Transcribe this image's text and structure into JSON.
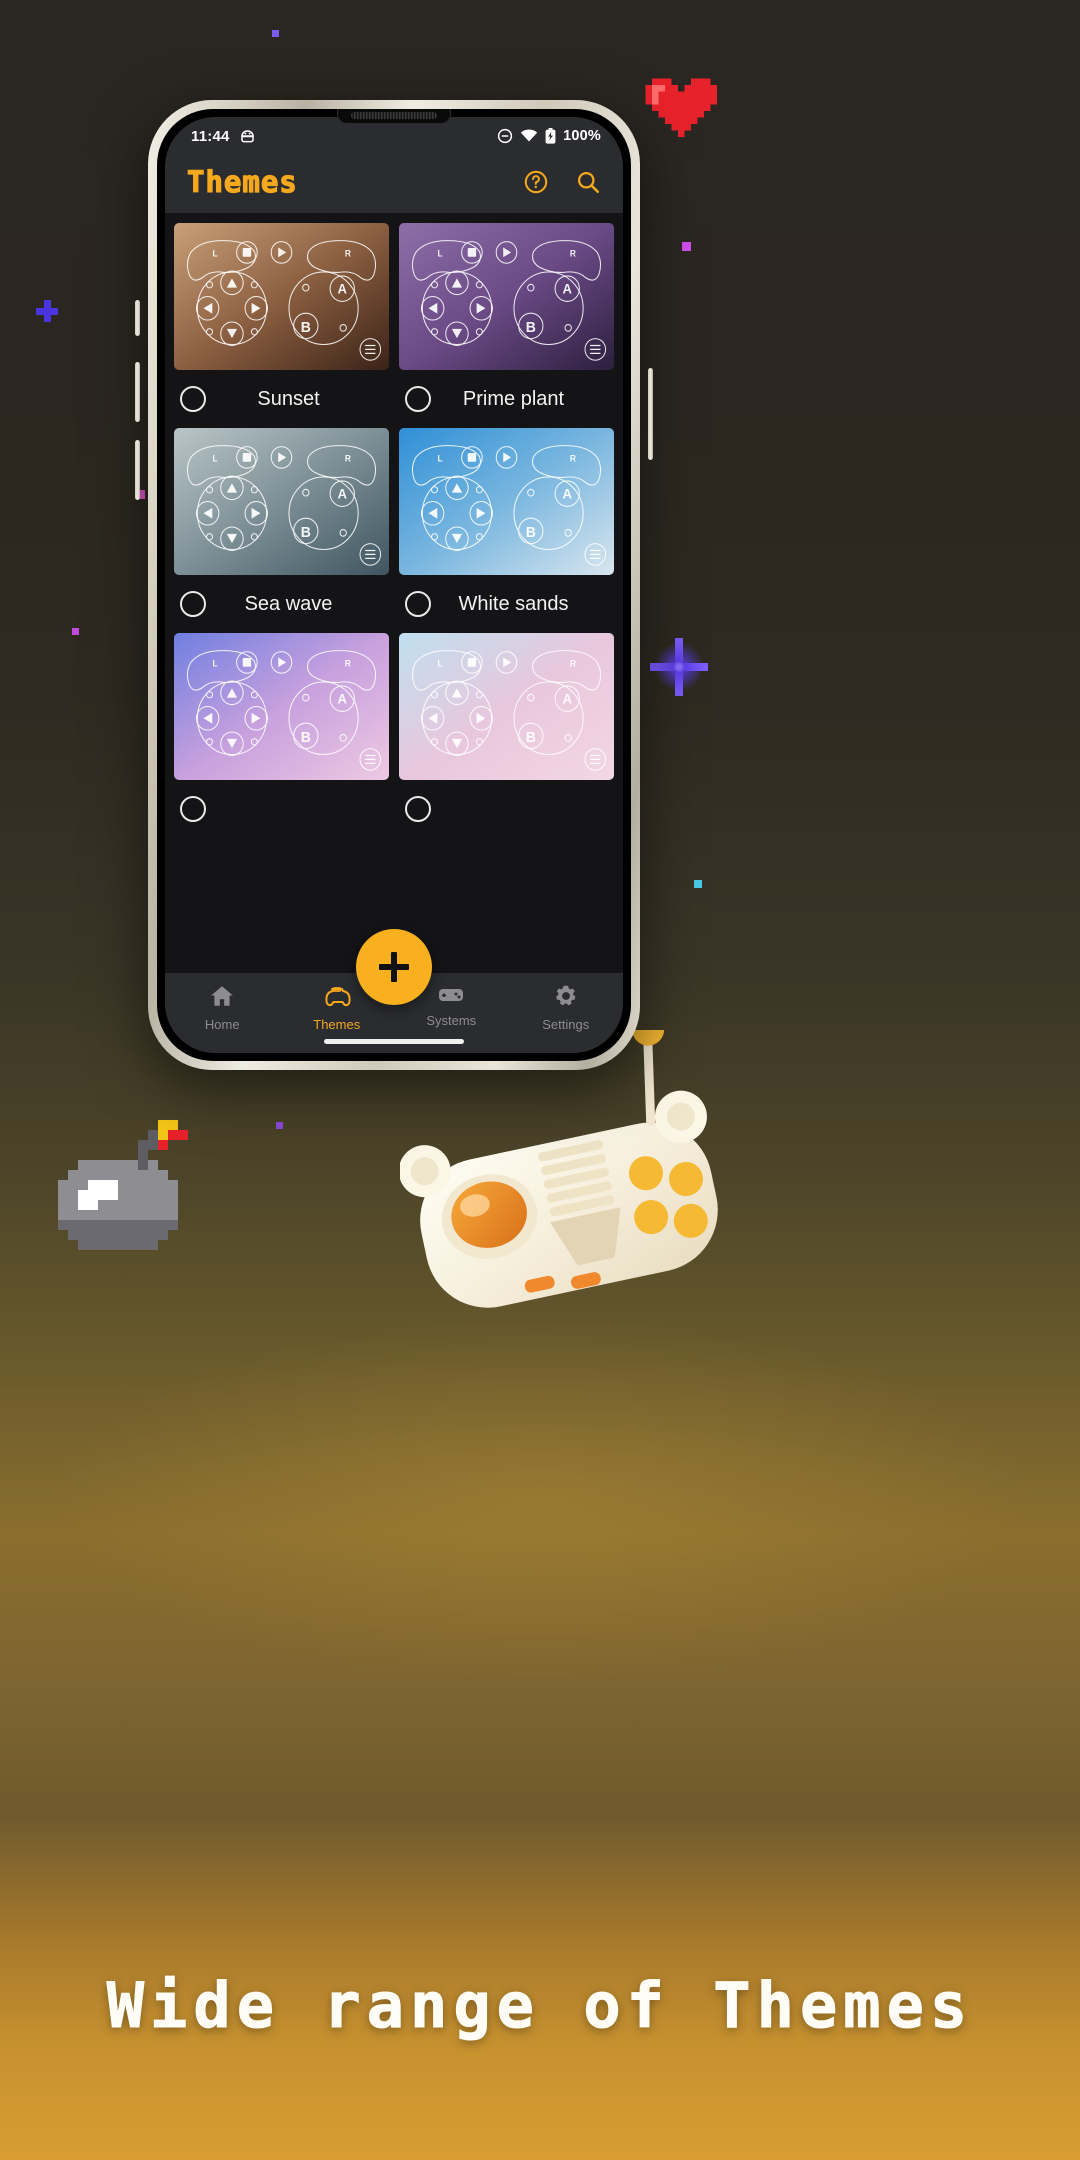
{
  "poster": {
    "caption": "Wide range of Themes",
    "bg_top": "#2a2621",
    "bg_bottom": "#d89c33"
  },
  "status_bar": {
    "time": "11:44",
    "left_icon": "android-icon",
    "dnd_icon": "do-not-disturb-icon",
    "wifi_icon": "wifi-icon",
    "battery_icon": "battery-charging-icon",
    "battery_text": "100%"
  },
  "app_bar": {
    "title": "Themes",
    "help_icon": "help-circle-icon",
    "search_icon": "search-icon",
    "accent": "#f5a81c"
  },
  "themes": [
    {
      "name": "Sunset",
      "selected": false,
      "bg_from": "#c9a079",
      "bg_via": "#8c5f41",
      "bg_to": "#3b2318",
      "overlay": "#ffffff"
    },
    {
      "name": "Prime plant",
      "selected": false,
      "bg_from": "#8e6fa8",
      "bg_via": "#6b4a86",
      "bg_to": "#2c1f3e",
      "overlay": "#ffffff"
    },
    {
      "name": "Sea wave",
      "selected": false,
      "bg_from": "#b9c6c8",
      "bg_via": "#7d8f96",
      "bg_to": "#3f5560",
      "overlay": "#ffffff"
    },
    {
      "name": "White sands",
      "selected": false,
      "bg_from": "#2f8fd6",
      "bg_via": "#79b6df",
      "bg_to": "#d9e6ef",
      "overlay": "#ffffff"
    },
    {
      "name": "",
      "selected": false,
      "bg_from": "#6f7fe0",
      "bg_via": "#c7a0de",
      "bg_to": "#eec9e2",
      "overlay": "#ffffff"
    },
    {
      "name": "",
      "selected": false,
      "bg_from": "#bfe0ef",
      "bg_via": "#e8c7dd",
      "bg_to": "#f3d7e4",
      "overlay": "#ffffff"
    }
  ],
  "controller": {
    "l_label": "L",
    "r_label": "R",
    "a_label": "A",
    "b_label": "B",
    "select_icon": "select-square-icon",
    "start_icon": "start-play-icon",
    "menu_icon": "menu-hamburger-icon",
    "dpad_up_icon": "dpad-up-icon",
    "dpad_down_icon": "dpad-down-icon",
    "dpad_left_icon": "dpad-left-icon",
    "dpad_right_icon": "dpad-right-icon"
  },
  "fab": {
    "icon": "plus-icon",
    "color": "#f8b01e"
  },
  "bottom_nav": {
    "items": [
      {
        "label": "Home",
        "icon": "home-icon",
        "active": false
      },
      {
        "label": "Themes",
        "icon": "gamepad-icon",
        "active": true
      },
      {
        "label": "Systems",
        "icon": "console-icon",
        "active": false
      },
      {
        "label": "Settings",
        "icon": "gear-icon",
        "active": false
      }
    ]
  }
}
